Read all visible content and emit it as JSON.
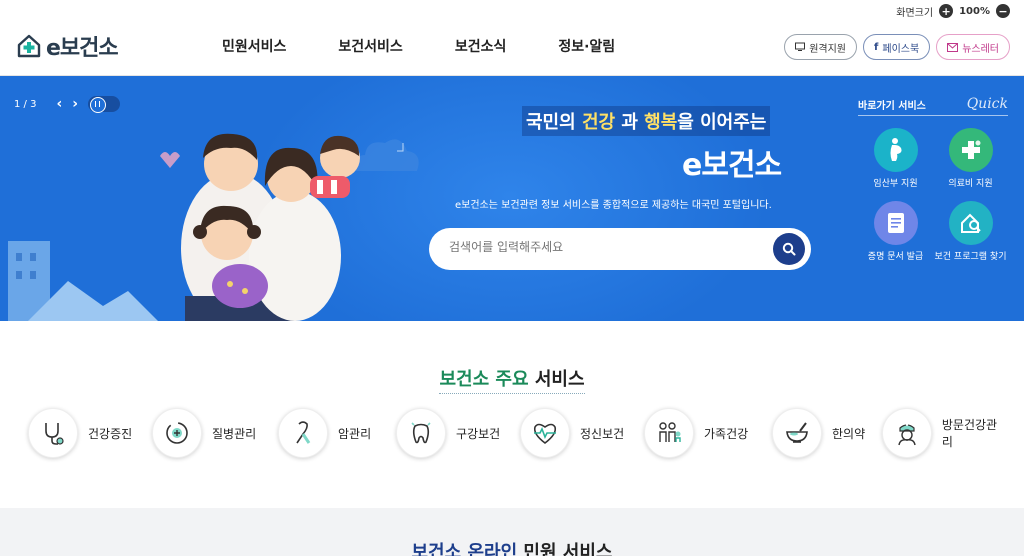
{
  "utility": {
    "zoom_label": "화면크기",
    "zoom_value": "100%",
    "zoom_in": "+",
    "zoom_out": "−"
  },
  "header": {
    "logo_text": "e보건소",
    "nav": [
      "민원서비스",
      "보건서비스",
      "보건소식",
      "정보·알림"
    ],
    "buttons": [
      {
        "label": "원격지원",
        "icon": "monitor-icon"
      },
      {
        "label": "페이스북",
        "icon": "facebook-icon"
      },
      {
        "label": "뉴스레터",
        "icon": "mail-icon"
      }
    ]
  },
  "hero": {
    "slide_counter": "1 / 3",
    "title_pre": "국민의 ",
    "title_hl1": "건강",
    "title_mid": " 과 ",
    "title_hl2": "행복",
    "title_post": "을 이어주는",
    "brand": "e보건소",
    "subtitle": "e보건소는 보건관련 정보 서비스를 종합적으로 제공하는 대국민 포털입니다.",
    "search_placeholder": "검색어를 입력해주세요"
  },
  "quick": {
    "title": "바로가기 서비스",
    "script": "Quick",
    "items": [
      {
        "label": "임산부 지원",
        "icon": "pregnant-icon",
        "color": "#1bb3c9"
      },
      {
        "label": "의료비 지원",
        "icon": "medical-cross-icon",
        "color": "#34b87a"
      },
      {
        "label": "증명 문서 발급",
        "icon": "document-icon",
        "color": "#6f86e8"
      },
      {
        "label": "보건 프로그램 찾기",
        "icon": "program-search-icon",
        "color": "#22b2c4"
      }
    ]
  },
  "services": {
    "title_green": "보건소 주요",
    "title_rest": " 서비스",
    "items": [
      {
        "label": "건강증진",
        "icon": "stethoscope-icon"
      },
      {
        "label": "질병관리",
        "icon": "disease-icon"
      },
      {
        "label": "암관리",
        "icon": "ribbon-icon"
      },
      {
        "label": "구강보건",
        "icon": "tooth-icon"
      },
      {
        "label": "정신보건",
        "icon": "heart-pulse-icon"
      },
      {
        "label": "가족건강",
        "icon": "family-icon"
      },
      {
        "label": "한의약",
        "icon": "mortar-icon"
      },
      {
        "label": "방문건강관리",
        "icon": "nurse-icon"
      }
    ]
  },
  "online": {
    "title_blue": "보건소 온라인",
    "title_rest": " 민원 서비스"
  },
  "colors": {
    "hero_bg": "#1f6fd8",
    "brand_green": "#1b8a5a",
    "navy": "#1d3e8c"
  }
}
